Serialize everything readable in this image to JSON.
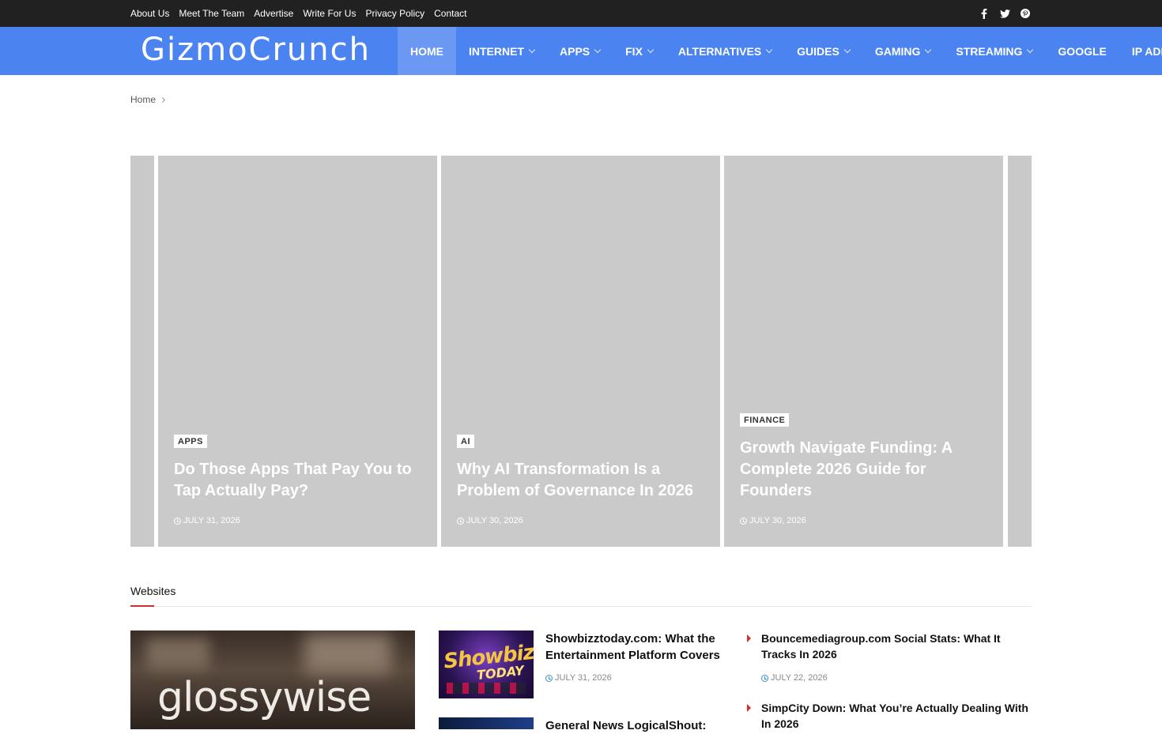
{
  "topbar": {
    "links": [
      "About Us",
      "Meet The Team",
      "Advertise",
      "Write For Us",
      "Privacy Policy",
      "Contact"
    ],
    "social_icons": [
      "facebook-icon",
      "twitter-icon",
      "pinterest-icon"
    ]
  },
  "header": {
    "logo": "GizmoCrunch",
    "nav": [
      {
        "label": "HOME",
        "active": true,
        "dropdown": false
      },
      {
        "label": "INTERNET",
        "dropdown": true
      },
      {
        "label": "APPS",
        "dropdown": true
      },
      {
        "label": "FIX",
        "dropdown": true
      },
      {
        "label": "ALTERNATIVES",
        "dropdown": true
      },
      {
        "label": "GUIDES",
        "dropdown": true
      },
      {
        "label": "GAMING",
        "dropdown": true
      },
      {
        "label": "STREAMING",
        "dropdown": true
      },
      {
        "label": "GOOGLE",
        "dropdown": false
      },
      {
        "label": "IP ADDR",
        "dropdown": false
      }
    ],
    "colors": {
      "nav_bg": "#4b84f0",
      "topbar_bg": "#212121"
    }
  },
  "breadcrumb": {
    "home": "Home"
  },
  "slider": {
    "slides": [
      {
        "category": "APPS",
        "title": "Do Those Apps That Pay You to Tap Actually Pay?",
        "date": "JULY 31, 2026"
      },
      {
        "category": "AI",
        "title": "Why AI Transformation Is a Problem of Governance In 2026",
        "date": "JULY 30, 2026"
      },
      {
        "category": "FINANCE",
        "title": "Growth Navigate Funding: A Complete 2026 Guide for Founders",
        "date": "JULY 30, 2026"
      }
    ]
  },
  "section": {
    "title": "Websites",
    "featured_image_text": "glossywise",
    "posts": [
      {
        "title": "Showbizztoday.com: What the Entertainment Platform Covers",
        "date": "JULY 31, 2026",
        "thumb_text": "Showbizz",
        "thumb_text2": "TODAY"
      },
      {
        "title": "General News LogicalShout:",
        "date": ""
      }
    ],
    "list": [
      {
        "title": "Bouncemediagroup.com Social Stats: What It Tracks In 2026",
        "date": "JULY 22, 2026"
      },
      {
        "title": "SimpCity Down: What You’re Actually Dealing With In 2026",
        "date": ""
      }
    ]
  }
}
